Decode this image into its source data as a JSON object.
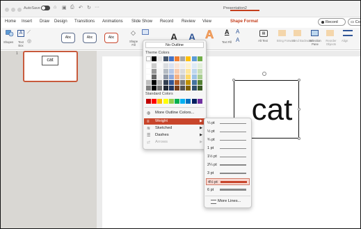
{
  "titlebar": {
    "autosave_label": "AutoSave",
    "document_title": "Presentation2"
  },
  "tabs": [
    "Home",
    "Insert",
    "Draw",
    "Design",
    "Transitions",
    "Animations",
    "Slide Show",
    "Record",
    "Review",
    "View",
    "Shape Format"
  ],
  "active_tab": "Shape Format",
  "buttons": {
    "record": "Record",
    "comments": "Co"
  },
  "ribbon": {
    "shapes_label": "Shapes",
    "textbox_label": "Text Box",
    "style_preview": "Abc",
    "shape_fill_label": "Shape Fill",
    "text_fill_label": "Text Fill",
    "alt_text_label": "Alt Text",
    "bring_forward_label": "Bring Forward",
    "send_backward_label": "Send Backward",
    "selection_pane_label": "Selection Pane",
    "reorder_objects_label": "Reorder Objects",
    "align_label": "Align",
    "wordart_letter": "A"
  },
  "slides_panel": {
    "slide_number": "1",
    "thumbnail_text": "cat"
  },
  "slide": {
    "shape_text": "cat"
  },
  "outline_menu": {
    "no_outline": "No Outline",
    "theme_colors_heading": "Theme Colors",
    "standard_colors_heading": "Standard Colors",
    "more_outline_colors": "More Outline Colors...",
    "weight": "Weight",
    "sketched": "Sketched",
    "dashes": "Dashes",
    "arrows": "Arrows"
  },
  "weight_menu": {
    "options": [
      "¼ pt",
      "½ pt",
      "¾ pt",
      "1 pt",
      "1½ pt",
      "2¼ pt",
      "3 pt",
      "4½ pt",
      "6 pt"
    ],
    "selected": "4½ pt",
    "more_lines": "More Lines..."
  },
  "colors": {
    "accent": "#c43e1c",
    "menu_highlight": "#c8452b",
    "theme_top_row": [
      "#ffffff",
      "#000000",
      "#e7e6e6",
      "#44546a",
      "#4472c4",
      "#ed7d31",
      "#a5a5a5",
      "#ffc000",
      "#5b9bd5",
      "#70ad47"
    ],
    "standard_colors": [
      "#c00000",
      "#ff0000",
      "#ffc000",
      "#ffff00",
      "#92d050",
      "#00b050",
      "#00b0f0",
      "#0070c0",
      "#002060",
      "#7030a0"
    ]
  }
}
